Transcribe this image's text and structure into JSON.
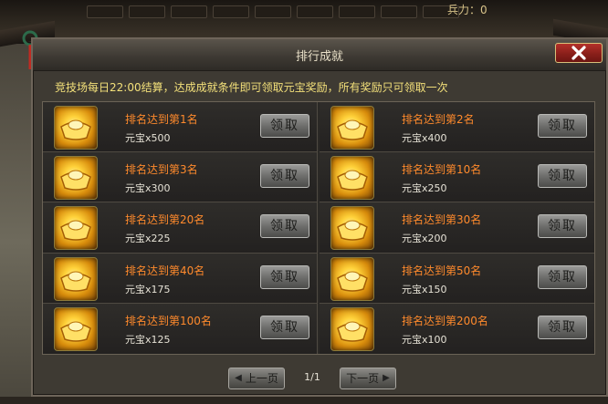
{
  "hud": {
    "troops_label": "兵力：0"
  },
  "dialog": {
    "title": "排行成就",
    "notice": "竞技场每日22:00结算，达成成就条件即可领取元宝奖励，所有奖励只可领取一次",
    "claim_label": "领取",
    "rewards": [
      {
        "rank_text": "排名达到第1名",
        "reward_text": "元宝x500"
      },
      {
        "rank_text": "排名达到第2名",
        "reward_text": "元宝x400"
      },
      {
        "rank_text": "排名达到第3名",
        "reward_text": "元宝x300"
      },
      {
        "rank_text": "排名达到第10名",
        "reward_text": "元宝x250"
      },
      {
        "rank_text": "排名达到第20名",
        "reward_text": "元宝x225"
      },
      {
        "rank_text": "排名达到第30名",
        "reward_text": "元宝x200"
      },
      {
        "rank_text": "排名达到第40名",
        "reward_text": "元宝x175"
      },
      {
        "rank_text": "排名达到第50名",
        "reward_text": "元宝x150"
      },
      {
        "rank_text": "排名达到第100名",
        "reward_text": "元宝x125"
      },
      {
        "rank_text": "排名达到第200名",
        "reward_text": "元宝x100"
      }
    ],
    "pagination": {
      "prev_label": "上一页",
      "next_label": "下一页",
      "page_indicator": "1/1"
    }
  },
  "colors": {
    "rank_text": "#ff8a2c",
    "notice_text": "#f3e07a",
    "close_button": "#b4312a",
    "ingot_gold": "#ffd23a"
  },
  "icons": {
    "reward": "gold-ingot-icon",
    "close": "close-icon",
    "prev": "arrow-left-icon",
    "next": "arrow-right-icon"
  }
}
